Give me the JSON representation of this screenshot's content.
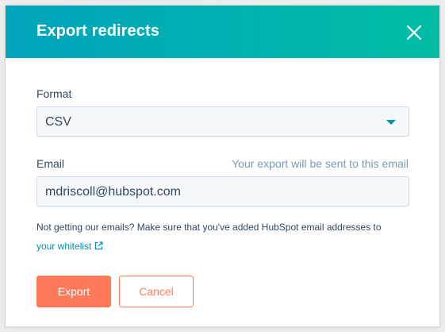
{
  "dialog": {
    "title": "Export redirects",
    "close_icon": "close-icon"
  },
  "format": {
    "label": "Format",
    "selected": "CSV"
  },
  "email": {
    "label": "Email",
    "hint": "Your export will be sent to this email",
    "value": "mdriscoll@hubspot.com"
  },
  "notice": {
    "text": "Not getting our emails? Make sure that you've added HubSpot email addresses to",
    "link_text": "your whitelist",
    "link_icon": "external-link-icon"
  },
  "actions": {
    "export_label": "Export",
    "cancel_label": "Cancel"
  },
  "colors": {
    "header_gradient_start": "#00a4bd",
    "header_gradient_end": "#00bda5",
    "primary": "#ff7a59",
    "link": "#0091ae",
    "text": "#33475b"
  }
}
